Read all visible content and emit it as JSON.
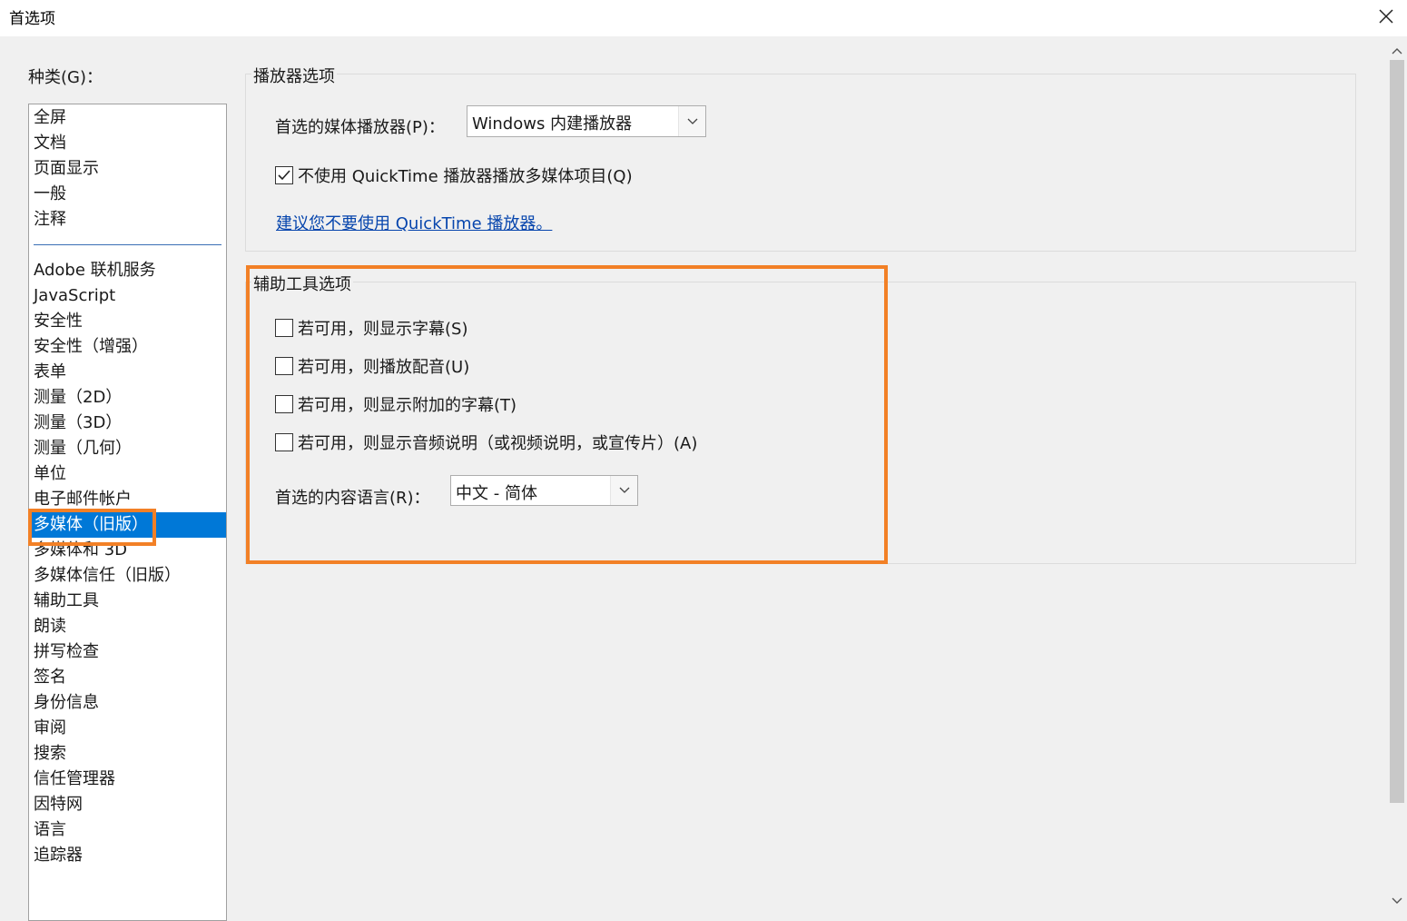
{
  "window": {
    "title": "首选项",
    "close_icon": "close-icon"
  },
  "categories": {
    "label": "种类(G)：",
    "group1": [
      "全屏",
      "文档",
      "页面显示",
      "一般",
      "注释"
    ],
    "group2": [
      "Adobe 联机服务",
      "JavaScript",
      "安全性",
      "安全性（增强）",
      "表单",
      "测量（2D）",
      "测量（3D）",
      "测量（几何）",
      "单位",
      "电子邮件帐户",
      "多媒体（旧版）",
      "多媒体和 3D",
      "多媒体信任（旧版）",
      "辅助工具",
      "朗读",
      "拼写检查",
      "签名",
      "身份信息",
      "审阅",
      "搜索",
      "信任管理器",
      "因特网",
      "语言",
      "追踪器"
    ],
    "selected": "多媒体（旧版）"
  },
  "player_options": {
    "title": "播放器选项",
    "preferred_player_label": "首选的媒体播放器(P)：",
    "preferred_player_value": "Windows 内建播放器",
    "no_quicktime_label": "不使用 QuickTime 播放器播放多媒体项目(Q)",
    "no_quicktime_checked": true,
    "recommend_link": "建议您不要使用 QuickTime 播放器。"
  },
  "accessibility_options": {
    "title": "辅助工具选项",
    "checkboxes": [
      {
        "label": "若可用，则显示字幕(S)",
        "checked": false
      },
      {
        "label": "若可用，则播放配音(U)",
        "checked": false
      },
      {
        "label": "若可用，则显示附加的字幕(T)",
        "checked": false
      },
      {
        "label": "若可用，则显示音频说明（或视频说明，或宣传片）(A)",
        "checked": false
      }
    ],
    "language_label": "首选的内容语言(R)：",
    "language_value": "中文 - 简体"
  },
  "colors": {
    "highlight": "#f28026",
    "selection": "#0078d7",
    "link": "#0645ad"
  }
}
